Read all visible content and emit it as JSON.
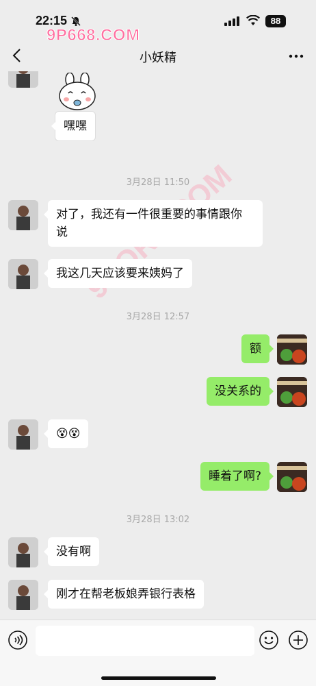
{
  "status": {
    "time": "22:15",
    "battery": "88"
  },
  "watermark": {
    "top": "9P668.COM",
    "diagonal": "9PORN.COM"
  },
  "header": {
    "title": "小妖精"
  },
  "sticker": {
    "caption": "嘿嘿"
  },
  "messages": {
    "m1": "对了，我还有一件很重要的事情跟你说",
    "m1_line1": "对了，我还有一件很重要的事情跟你",
    "m1_line2": "说",
    "m2": "我这几天应该要来姨妈了",
    "m3": "额",
    "m4": "没关系的",
    "m5": "😵😵",
    "m6": "睡着了啊?",
    "m7": "没有啊",
    "m8": "刚才在帮老板娘弄银行表格"
  },
  "timestamps": {
    "t1": "3月28日 11:50",
    "t2": "3月28日 12:57",
    "t3": "3月28日 13:02"
  },
  "icons": {
    "back": "chevron-left-icon",
    "more": "more-icon",
    "voice": "voice-icon",
    "emoji": "emoji-icon",
    "plus": "plus-icon",
    "mute": "bell-slash-icon"
  },
  "colors": {
    "bubble_self": "#95ec69",
    "bubble_other": "#ffffff",
    "background": "#ededed"
  }
}
